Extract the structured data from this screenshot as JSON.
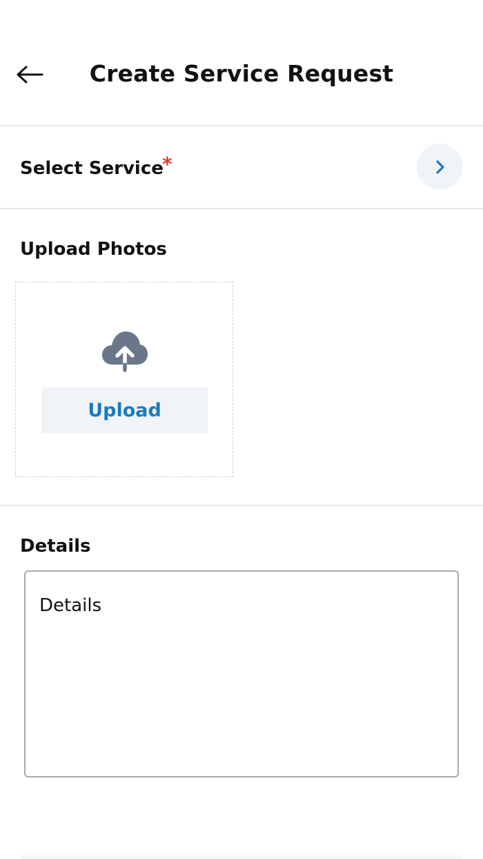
{
  "header": {
    "title": "Create Service Request",
    "back_icon": "arrow-left-icon"
  },
  "select_service": {
    "label": "Select Service",
    "required_mark": "*",
    "chevron_icon": "chevron-right-icon"
  },
  "upload": {
    "section_label": "Upload Photos",
    "icon": "cloud-upload-icon",
    "button_label": "Upload"
  },
  "details": {
    "section_label": "Details",
    "placeholder": "Details",
    "value": ""
  },
  "colors": {
    "accent": "#1a7bbd",
    "required": "#e53935",
    "icon_gray": "#6b7789",
    "button_bg": "#f1f4f7",
    "divider": "#e4e6e9"
  }
}
